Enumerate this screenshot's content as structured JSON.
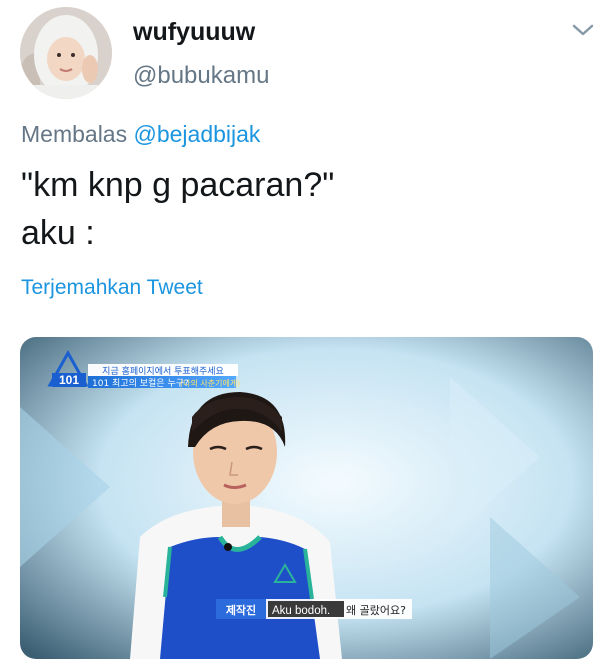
{
  "tweet": {
    "display_name": "wufyuuuw",
    "handle": "@bubukamu",
    "reply_prefix": "Membalas",
    "reply_to": "@bejadbijak",
    "text_line1": "\"km knp g pacaran?\"",
    "text_line2": "aku :",
    "translate_label": "Terjemahkan Tweet"
  },
  "media": {
    "banner_top": "지금 홈페이지에서 투표해주세요",
    "banner_bottom": "101 최고의 보컬은 누구?",
    "banner_tag": "(나의 사춘기에게)",
    "logo_text": "101",
    "subtitle_speaker": "제작진",
    "subtitle_text": "Aku bodoh.",
    "subtitle_korean_tail": "왜 골랐어요?"
  },
  "colors": {
    "link": "#1b95e0",
    "secondary_text": "#657786",
    "primary_text": "#14171a"
  },
  "icons": {
    "caret": "chevron-down-icon"
  }
}
